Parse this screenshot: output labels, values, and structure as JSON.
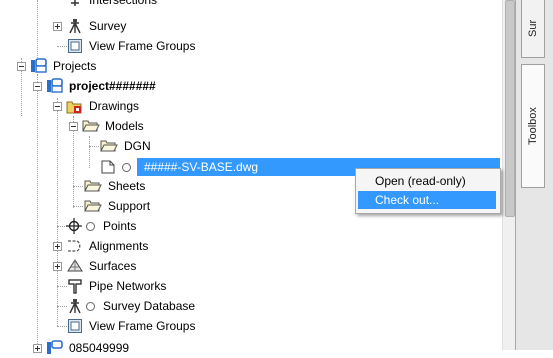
{
  "tree": {
    "intersections": "Intersections",
    "survey": "Survey",
    "view_frame_groups_top": "View Frame Groups",
    "projects": "Projects",
    "project": "project#######",
    "drawings": "Drawings",
    "models": "Models",
    "dgn": "DGN",
    "file": "#####-SV-BASE.dwg",
    "sheets": "Sheets",
    "support": "Support",
    "points": "Points",
    "alignments": "Alignments",
    "surfaces": "Surfaces",
    "pipe_networks": "Pipe Networks",
    "survey_database": "Survey Database",
    "view_frame_groups_bottom": "View Frame Groups",
    "project2": "085049999"
  },
  "context_menu": {
    "open_readonly": "Open (read-only)",
    "check_out": "Check out..."
  },
  "side_tabs": {
    "top": "Sur",
    "toolbox": "Toolbox"
  },
  "colors": {
    "selection": "#3399ff",
    "folder": "#f0d060"
  }
}
